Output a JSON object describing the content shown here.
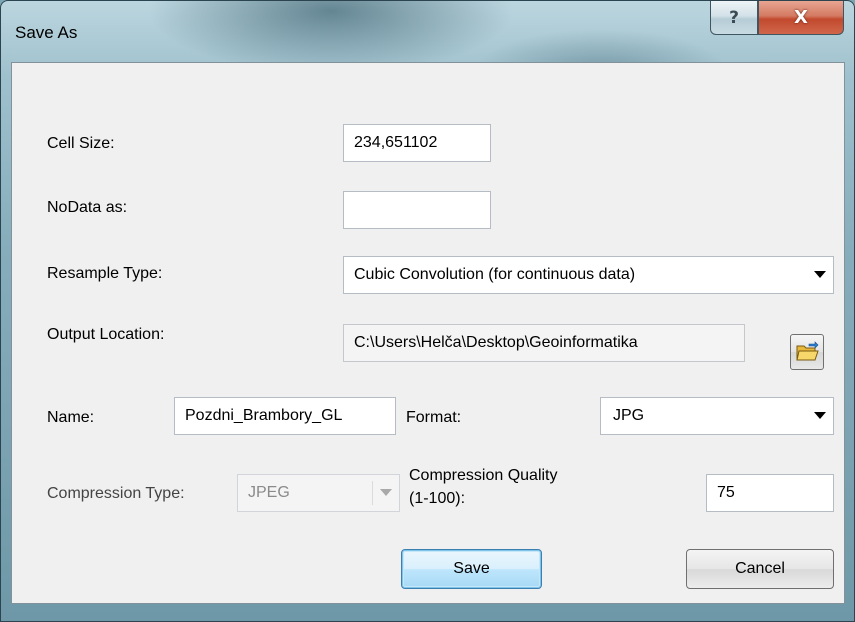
{
  "window": {
    "title": "Save As",
    "help_label": "?",
    "close_label": "X"
  },
  "form": {
    "cell_size": {
      "label": "Cell Size:",
      "value": "234,651102"
    },
    "nodata": {
      "label": "NoData as:",
      "value": ""
    },
    "resample": {
      "label": "Resample Type:",
      "value": "Cubic Convolution (for continuous data)"
    },
    "output_location": {
      "label": "Output Location:",
      "value": "C:\\Users\\Helča\\Desktop\\Geoinformatika"
    },
    "name": {
      "label": "Name:",
      "value": "Pozdni_Brambory_GL"
    },
    "format": {
      "label": "Format:",
      "value": "JPG"
    },
    "compression_type": {
      "label": "Compression Type:",
      "value": "JPEG",
      "enabled": false
    },
    "compression_quality": {
      "label_line1": "Compression Quality",
      "label_line2": "(1-100):",
      "value": "75"
    }
  },
  "buttons": {
    "save": "Save",
    "cancel": "Cancel"
  },
  "icons": {
    "browse": "open-folder-icon",
    "dropdown": "chevron-down-icon"
  },
  "colors": {
    "dialog_bg": "#f0f0f0",
    "close_button": "#c24a2e",
    "default_button_border": "#3c7fb1"
  }
}
